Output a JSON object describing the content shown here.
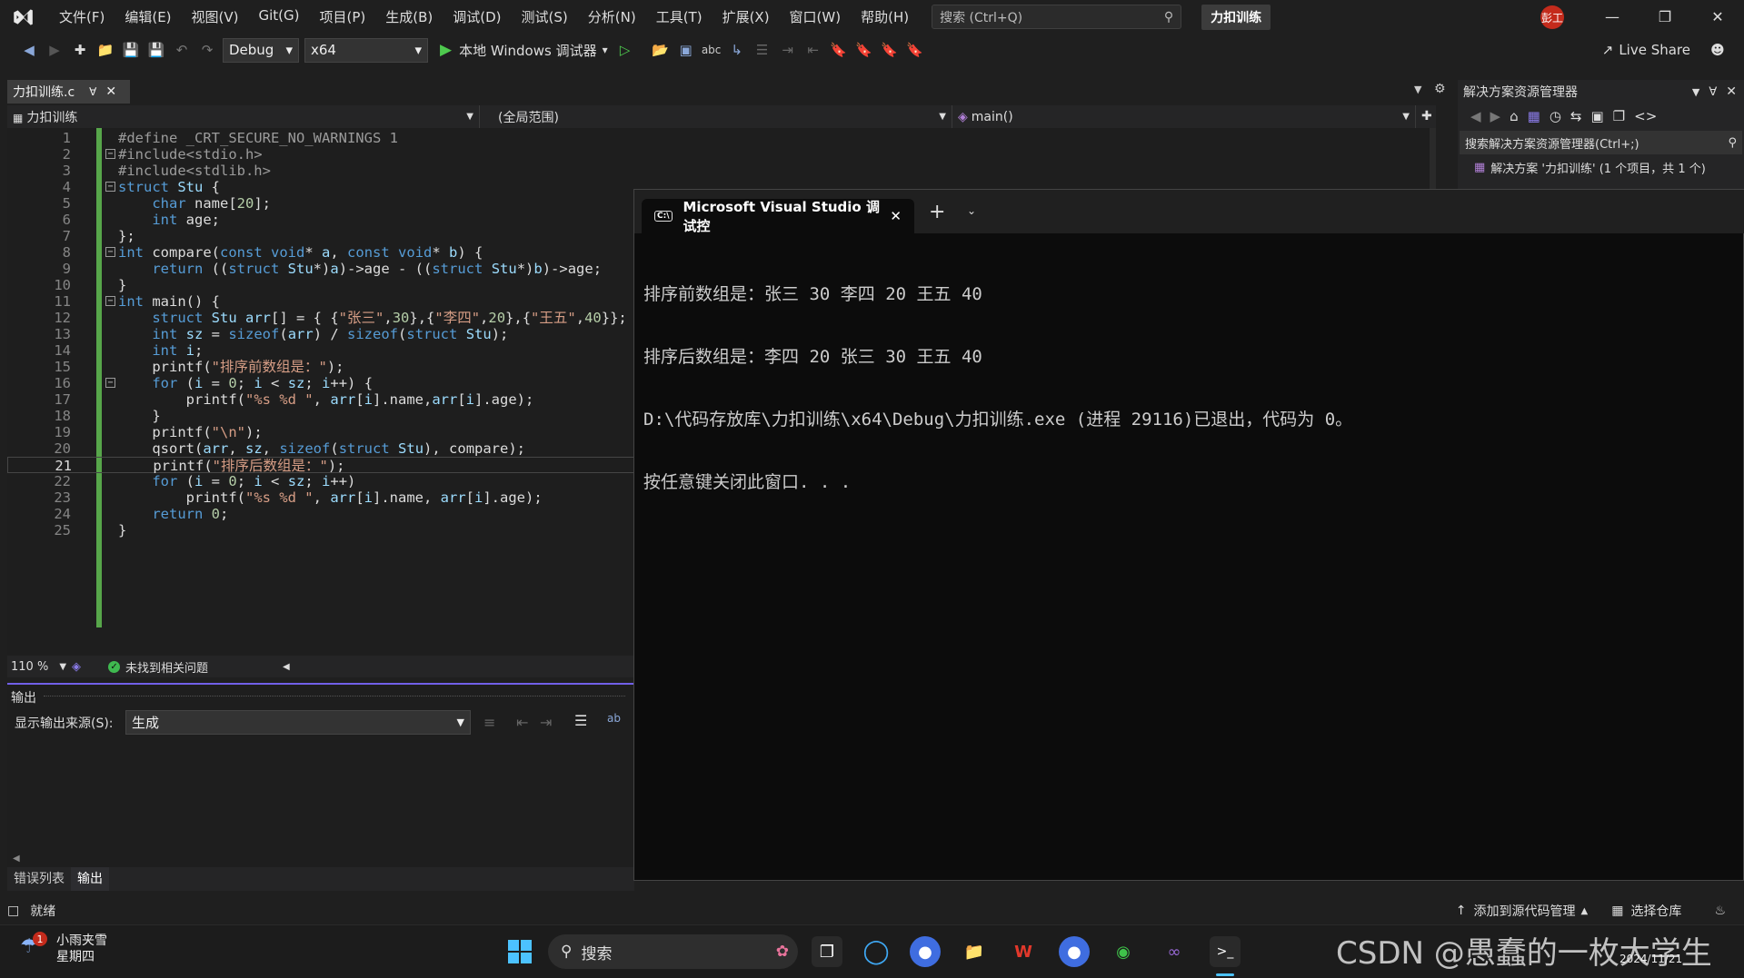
{
  "menubar": {
    "items": [
      "文件(F)",
      "编辑(E)",
      "视图(V)",
      "Git(G)",
      "项目(P)",
      "生成(B)",
      "调试(D)",
      "测试(S)",
      "分析(N)",
      "工具(T)",
      "扩展(X)",
      "窗口(W)",
      "帮助(H)"
    ],
    "search_placeholder": "搜索 (Ctrl+Q)",
    "solution_name": "力扣训练",
    "avatar_text": "彭工"
  },
  "toolbar": {
    "config": "Debug",
    "platform": "x64",
    "run_label": "本地 Windows 调试器",
    "live_share": "Live Share"
  },
  "editor": {
    "tab_title": "力扣训练.c",
    "nav_project": "力扣训练",
    "nav_scope": "(全局范围)",
    "nav_member": "main()",
    "zoom": "110 %",
    "issues": "未找到相关问题",
    "current_line": 21,
    "lines": [
      {
        "n": "1",
        "t": "#define _CRT_SECURE_NO_WARNINGS 1"
      },
      {
        "n": "2",
        "t": "#include<stdio.h>"
      },
      {
        "n": "3",
        "t": "#include<stdlib.h>"
      },
      {
        "n": "4",
        "t": "struct Stu {"
      },
      {
        "n": "5",
        "t": "    char name[20];"
      },
      {
        "n": "6",
        "t": "    int age;"
      },
      {
        "n": "7",
        "t": "};"
      },
      {
        "n": "8",
        "t": "int compare(const void* a, const void* b) {"
      },
      {
        "n": "9",
        "t": "    return ((struct Stu*)a)->age - ((struct Stu*)b)->age;"
      },
      {
        "n": "10",
        "t": "}"
      },
      {
        "n": "11",
        "t": "int main() {"
      },
      {
        "n": "12",
        "t": "    struct Stu arr[] = { {\"张三\",30},{\"李四\",20},{\"王五\",40}};"
      },
      {
        "n": "13",
        "t": "    int sz = sizeof(arr) / sizeof(struct Stu);"
      },
      {
        "n": "14",
        "t": "    int i;"
      },
      {
        "n": "15",
        "t": "    printf(\"排序前数组是：\");"
      },
      {
        "n": "16",
        "t": "    for (i = 0; i < sz; i++) {"
      },
      {
        "n": "17",
        "t": "        printf(\"%s %d \", arr[i].name,arr[i].age);"
      },
      {
        "n": "18",
        "t": "    }"
      },
      {
        "n": "19",
        "t": "    printf(\"\\n\");"
      },
      {
        "n": "20",
        "t": "    qsort(arr, sz, sizeof(struct Stu), compare);"
      },
      {
        "n": "21",
        "t": "    printf(\"排序后数组是：\");"
      },
      {
        "n": "22",
        "t": "    for (i = 0; i < sz; i++)"
      },
      {
        "n": "23",
        "t": "        printf(\"%s %d \", arr[i].name, arr[i].age);"
      },
      {
        "n": "24",
        "t": "    return 0;"
      },
      {
        "n": "25",
        "t": "}"
      }
    ]
  },
  "output_panel": {
    "title": "输出",
    "source_label": "显示输出来源(S):",
    "source_value": "生成",
    "tabs": [
      "错误列表",
      "输出"
    ]
  },
  "solution_explorer": {
    "title": "解决方案资源管理器",
    "search_placeholder": "搜索解决方案资源管理器(Ctrl+;)",
    "root": "解决方案 '力扣训练' (1 个项目，共 1 个)"
  },
  "statusbar": {
    "ready": "就绪",
    "add_source_control": "添加到源代码管理",
    "select_repo": "选择仓库"
  },
  "terminal": {
    "tab_title": "Microsoft Visual Studio 调试控",
    "lines": [
      "排序前数组是：张三 30 李四 20 王五 40",
      "排序后数组是：李四 20 张三 30 王五 40",
      "D:\\代码存放库\\力扣训练\\x64\\Debug\\力扣训练.exe (进程 29116)已退出，代码为 0。",
      "按任意键关闭此窗口. . ."
    ]
  },
  "taskbar": {
    "weather": "小雨夹雪",
    "weekday": "星期四",
    "weather_badge": "1",
    "search_label": "搜索",
    "date": "2024/11/21",
    "watermark": "CSDN @愚蠢的一枚大学生"
  }
}
